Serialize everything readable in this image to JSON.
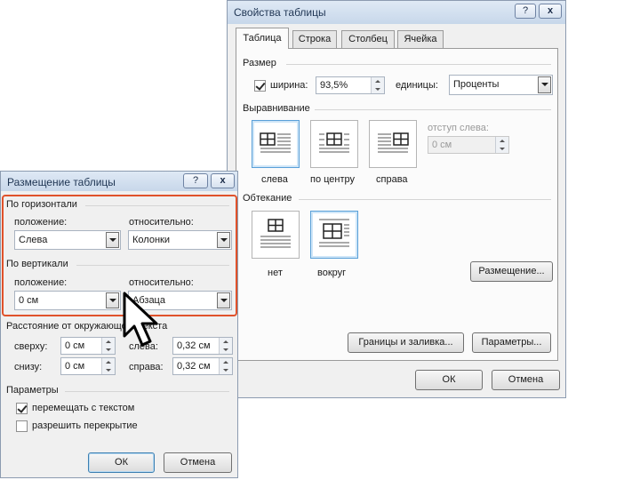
{
  "table_props": {
    "title": "Свойства таблицы",
    "help": "?",
    "close": "x",
    "tabs": [
      "Таблица",
      "Строка",
      "Столбец",
      "Ячейка"
    ],
    "size_group": "Размер",
    "width_label": "ширина:",
    "width_value": "93,5%",
    "units_label": "единицы:",
    "units_value": "Проценты",
    "align_group": "Выравнивание",
    "align_options": [
      "слева",
      "по центру",
      "справа"
    ],
    "indent_label": "отступ слева:",
    "indent_value": "0 см",
    "wrap_group": "Обтекание",
    "wrap_options": [
      "нет",
      "вокруг"
    ],
    "placement_button": "Размещение...",
    "borders_button": "Границы и заливка...",
    "params_button": "Параметры...",
    "ok": "ОК",
    "cancel": "Отмена"
  },
  "placement": {
    "title": "Размещение таблицы",
    "help": "?",
    "close": "x",
    "horizontal_group": "По горизонтали",
    "h_position_label": "положение:",
    "h_position_value": "Слева",
    "h_relative_label": "относительно:",
    "h_relative_value": "Колонки",
    "vertical_group": "По вертикали",
    "v_position_label": "положение:",
    "v_position_value": "0 см",
    "v_relative_label": "относительно:",
    "v_relative_value": "Абзаца",
    "distance_group": "Расстояние от окружающего текста",
    "top_label": "сверху:",
    "top_value": "0 см",
    "bottom_label": "снизу:",
    "bottom_value": "0 см",
    "left_label": "слева:",
    "left_value": "0,32 см",
    "right_label": "справа:",
    "right_value": "0,32 см",
    "params_group": "Параметры",
    "move_with_text": "перемещать с текстом",
    "move_with_text_checked": true,
    "allow_overlap": "разрешить перекрытие",
    "allow_overlap_checked": false,
    "ok": "ОК",
    "cancel": "Отмена"
  },
  "colors": {
    "highlight": "#e0522b",
    "selection": "#5aa0d8"
  }
}
